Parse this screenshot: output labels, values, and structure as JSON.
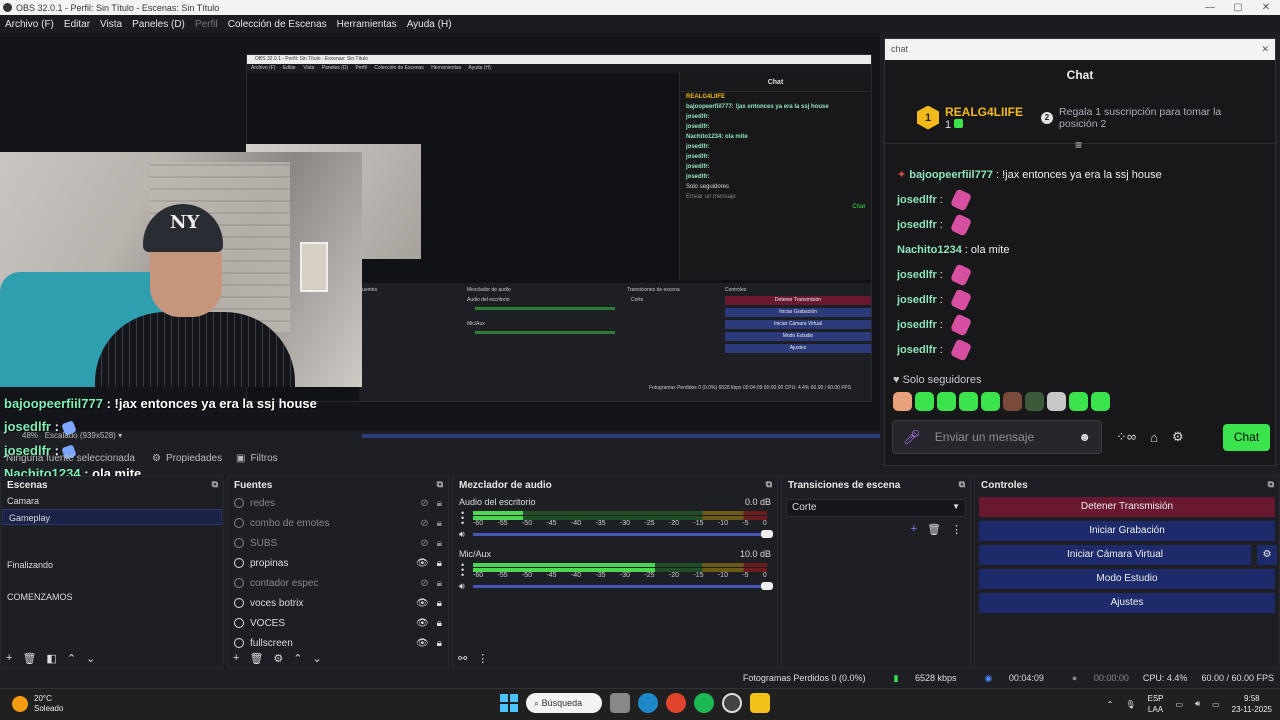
{
  "window": {
    "title": "OBS 32.0.1 - Perfil: Sin Título - Escenas: Sin Título",
    "controls": [
      "—",
      "▢",
      "✕"
    ]
  },
  "menu": [
    {
      "label": "Archivo (F)",
      "dim": false
    },
    {
      "label": "Editar",
      "dim": false
    },
    {
      "label": "Vista",
      "dim": false
    },
    {
      "label": "Paneles (D)",
      "dim": false
    },
    {
      "label": "Perfil",
      "dim": true
    },
    {
      "label": "Colección de Escenas",
      "dim": false
    },
    {
      "label": "Herramientas",
      "dim": false
    },
    {
      "label": "Ayuda (H)",
      "dim": false
    }
  ],
  "nested_preview": {
    "title": "OBS 32.0.1 - Perfil: Sin Título - Escenas: Sin Título",
    "menu": [
      "Archivo (F)",
      "Editar",
      "Vista",
      "Paneles (D)",
      "Perfil",
      "Colección de Escenas",
      "Herramientas",
      "Ayuda (H)"
    ],
    "chat_title": "Chat",
    "leader": "REALG4LIIFE",
    "messages": [
      "bajoopeerfiil777: !jax entonces ya era la ssj house",
      "josedlfr:",
      "josedlfr:",
      "Nachito1234: ola mite",
      "josedlfr:",
      "josedlfr:",
      "josedlfr:",
      "josedlfr:"
    ],
    "followers": "Solo seguidores",
    "input": "Enviar un mensaje",
    "send": "Chat",
    "docks": [
      "Fuentes",
      "Mezclador de audio",
      "Transiciones de escena",
      "Controles"
    ],
    "buttons": [
      "Detener Transmisión",
      "Iniciar Grabación",
      "Iniciar Cámara Virtual",
      "Modo Estudio",
      "Ajustes"
    ],
    "mixer": [
      "Audio del escritorio",
      "Mic/Aux"
    ],
    "transition": "Corte",
    "status": "Fotogramas Perdidos 0 (0.0%)    6528 kbps    00:04:09    00:00:00    CPU: 4.4%    60.00 / 60.00 FPS"
  },
  "overlay_chat": [
    {
      "user": "bajoopeerfiil777",
      "text": " : !jax entonces ya era la ssj house",
      "emote": false
    },
    {
      "user": "josedlfr",
      "text": " :",
      "emote": true
    },
    {
      "user": "josedlfr",
      "text": " :",
      "emote": true
    },
    {
      "user": "Nachito1234",
      "text": " : ola mite",
      "emote": false
    },
    {
      "user": "josedlfr",
      "text": " :",
      "emote": true
    },
    {
      "user": "josedlfr",
      "text": " :",
      "emote": true
    },
    {
      "user": "josedlfr",
      "text": " :",
      "emote": true
    },
    {
      "user": "josedlfr",
      "text": " :",
      "emote": true
    }
  ],
  "preview_status": {
    "zoom": "48%",
    "scaled": "Escalado (939x528)"
  },
  "toolbar": {
    "no_source": "Ninguna fuente seleccionada",
    "properties": "Propiedades",
    "filters": "Filtros"
  },
  "chat": {
    "window_title": "chat",
    "close": "✕",
    "title": "Chat",
    "leader": {
      "rank": "1",
      "name": "REALG4LIIFE",
      "subs": "1",
      "rank2": "2",
      "slot2": "Regala 1 suscripción para tomar la posición 2"
    },
    "messages": [
      {
        "user": "bajoopeerfiil777",
        "text": ": !jax entonces ya era la ssj house",
        "emote": false
      },
      {
        "user": "josedlfr",
        "text": ":",
        "emote": true
      },
      {
        "user": "josedlfr",
        "text": ":",
        "emote": true
      },
      {
        "user": "Nachito1234",
        "text": ": ola mite",
        "emote": false
      },
      {
        "user": "josedlfr",
        "text": ":",
        "emote": true
      },
      {
        "user": "josedlfr",
        "text": ":",
        "emote": true
      },
      {
        "user": "josedlfr",
        "text": ":",
        "emote": true
      },
      {
        "user": "josedlfr",
        "text": ":",
        "emote": true
      }
    ],
    "followers": "Solo seguidores",
    "emote_colors": [
      "#e7a27c",
      "#3be34d",
      "#3be34d",
      "#3be34d",
      "#3be34d",
      "#7a4a3a",
      "#3a5a3a",
      "#c8c8c8",
      "#3be34d",
      "#3be34d"
    ],
    "input_placeholder": "Enviar un mensaje",
    "send": "Chat"
  },
  "scenes": {
    "title": "Escenas",
    "items": [
      "Camara",
      "Gameplay",
      "",
      "",
      "Finalizando",
      "",
      "COMENZAMOS"
    ],
    "selected": 1
  },
  "sources": {
    "title": "Fuentes",
    "items": [
      {
        "name": "redes",
        "visible": false,
        "locked": true
      },
      {
        "name": "combo de emotes",
        "visible": false,
        "locked": true
      },
      {
        "name": "SUBS",
        "visible": false,
        "locked": true
      },
      {
        "name": "propinas",
        "visible": true,
        "locked": true
      },
      {
        "name": "contador espec",
        "visible": false,
        "locked": true
      },
      {
        "name": "voces botrix",
        "visible": true,
        "locked": true
      },
      {
        "name": "VOCES",
        "visible": true,
        "locked": true
      },
      {
        "name": "fullscreen",
        "visible": true,
        "locked": true
      }
    ]
  },
  "mixer": {
    "title": "Mezclador de audio",
    "channels": [
      {
        "name": "Audio del escritorio",
        "db": "0.0 dB",
        "level": 0.17
      },
      {
        "name": "Mic/Aux",
        "db": "10.0 dB",
        "level": 0.62
      }
    ],
    "scale": [
      "-60",
      "-55",
      "-50",
      "-45",
      "-40",
      "-35",
      "-30",
      "-25",
      "-20",
      "-15",
      "-10",
      "-5",
      "0"
    ]
  },
  "transitions": {
    "title": "Transiciones de escena",
    "selected": "Corte"
  },
  "controls": {
    "title": "Controles",
    "stop_stream": "Detener Transmisión",
    "start_recording": "Iniciar Grabación",
    "virtual_cam": "Iniciar Cámara Virtual",
    "studio_mode": "Modo Estudio",
    "settings": "Ajustes"
  },
  "status": {
    "dropped": "Fotogramas Perdidos 0 (0.0%)",
    "bitrate": "6528 kbps",
    "stream_time": "00:04:09",
    "rec_time": "00:00:00",
    "cpu": "CPU: 4.4%",
    "fps": "60.00 / 60.00 FPS"
  },
  "taskbar": {
    "temp": "20°C",
    "weather": "Soleado",
    "search": "Búsqueda",
    "lang1": "ESP",
    "lang2": "LAA",
    "time": "9:58",
    "date": "23-11-2025"
  }
}
